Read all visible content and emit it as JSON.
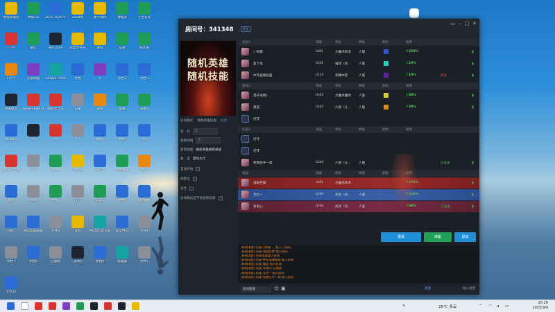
{
  "desktop": {
    "icons": [
      {
        "label": "地址和电话",
        "icon": "folder-icon",
        "color": "#e6b800"
      },
      {
        "label": "中级Gis",
        "icon": "excel-icon",
        "color": "#1f9c55"
      },
      {
        "label": "2025-2026学年",
        "icon": "word-icon",
        "color": "#2b6bd6"
      },
      {
        "label": "2024年",
        "icon": "folder-icon",
        "color": "#e6b800"
      },
      {
        "label": "教学资料",
        "icon": "folder-icon",
        "color": "#e6b800"
      },
      {
        "label": "课程表",
        "icon": "excel-icon",
        "color": "#1f9c55"
      },
      {
        "label": "学生名单",
        "icon": "excel-icon",
        "color": "#1f9c55"
      },
      {
        "label": "TTYY",
        "icon": "app-icon",
        "color": "#d8342f"
      },
      {
        "label": "微信",
        "icon": "wechat-icon",
        "color": "#1f9c55"
      },
      {
        "label": "WeGame",
        "icon": "wegame-icon",
        "color": "#1e2530"
      },
      {
        "label": "新建文件夹",
        "icon": "folder-icon",
        "color": "#e6b800"
      },
      {
        "label": "资料",
        "icon": "folder-icon",
        "color": "#e6b800"
      },
      {
        "label": "成绩",
        "icon": "excel-icon",
        "color": "#1f9c55"
      },
      {
        "label": "统计表",
        "icon": "excel-icon",
        "color": "#1f9c55"
      },
      {
        "label": "TTYYY",
        "icon": "app-icon",
        "color": "#e8870e"
      },
      {
        "label": "百度网盘",
        "icon": "app-icon",
        "color": "#7c3fc1"
      },
      {
        "label": "Google Chrome",
        "icon": "chrome-icon",
        "color": "#14a3a0"
      },
      {
        "label": "文档",
        "icon": "word-icon",
        "color": "#2b6bd6"
      },
      {
        "label": "AI",
        "icon": "ai-icon",
        "color": "#7c3fc1"
      },
      {
        "label": "文档2",
        "icon": "word-icon",
        "color": "#2b6bd6"
      },
      {
        "label": "文档3",
        "icon": "word-icon",
        "color": "#2b6bd6"
      },
      {
        "label": "英雄联盟",
        "icon": "game-icon",
        "color": "#1e2530"
      },
      {
        "label": "Apex Legends",
        "icon": "game-icon",
        "color": "#d8342f"
      },
      {
        "label": "网易云音乐",
        "icon": "music-icon",
        "color": "#d8342f"
      },
      {
        "label": "记录",
        "icon": "doc-icon",
        "color": "#8b8f99"
      },
      {
        "label": "游戏",
        "icon": "game-icon",
        "color": "#e8870e"
      },
      {
        "label": "表格",
        "icon": "excel-icon",
        "color": "#1f9c55"
      },
      {
        "label": "表格2",
        "icon": "excel-icon",
        "color": "#1f9c55"
      },
      {
        "label": "bilibili",
        "icon": "app-icon",
        "color": "#2b6bd6"
      },
      {
        "label": "PS",
        "icon": "ps-icon",
        "color": "#1e2530"
      },
      {
        "label": "XX",
        "icon": "app-icon",
        "color": "#d8342f"
      },
      {
        "label": "人人",
        "icon": "doc-icon",
        "color": "#8b8f99"
      },
      {
        "label": "文档4",
        "icon": "word-icon",
        "color": "#2b6bd6"
      },
      {
        "label": "文档5",
        "icon": "word-icon",
        "color": "#2b6bd6"
      },
      {
        "label": "QQ",
        "icon": "qq-icon",
        "color": "#2b6bd6"
      },
      {
        "label": "WPS Office",
        "icon": "wps-icon",
        "color": "#d8342f"
      },
      {
        "label": "TTT",
        "icon": "doc-icon",
        "color": "#8b8f99"
      },
      {
        "label": "文件",
        "icon": "doc-icon",
        "color": "#1f9c55"
      },
      {
        "label": "资料夹",
        "icon": "folder-icon",
        "color": "#e6b800"
      },
      {
        "label": "2025",
        "icon": "word-icon",
        "color": "#2b6bd6"
      },
      {
        "label": "文件管理",
        "icon": "app-icon",
        "color": "#1f9c55"
      },
      {
        "label": "用户",
        "icon": "user-icon",
        "color": "#e8870e"
      },
      {
        "label": "图片",
        "icon": "image-icon",
        "color": "#2b6bd6"
      },
      {
        "label": "MMM",
        "icon": "doc-icon",
        "color": "#8b8f99"
      },
      {
        "label": "文件2",
        "icon": "doc-icon",
        "color": "#1f9c55"
      },
      {
        "label": "TTT2",
        "icon": "doc-icon",
        "color": "#8b8f99"
      },
      {
        "label": "记录2",
        "icon": "excel-icon",
        "color": "#1f9c55"
      },
      {
        "label": "文档6",
        "icon": "word-icon",
        "color": "#2b6bd6"
      },
      {
        "label": "控制面板",
        "icon": "app-icon",
        "color": "#2b6bd6"
      },
      {
        "label": "KK",
        "icon": "app-icon",
        "color": "#2b6bd6"
      },
      {
        "label": "腾讯电脑管家",
        "icon": "app-icon",
        "color": "#2b6bd6"
      },
      {
        "label": "文件3",
        "icon": "doc-icon",
        "color": "#8b8f99"
      },
      {
        "label": "Bin",
        "icon": "app-icon",
        "color": "#e6b800"
      },
      {
        "label": "Microsoft Edge",
        "icon": "edge-icon",
        "color": "#14a3a0"
      },
      {
        "label": "安全中心",
        "icon": "app-icon",
        "color": "#2b6bd6"
      },
      {
        "label": "文件4",
        "icon": "doc-icon",
        "color": "#8b8f99"
      },
      {
        "label": "文档7",
        "icon": "doc-icon",
        "color": "#8b8f99"
      },
      {
        "label": "文档8",
        "icon": "word-icon",
        "color": "#2b6bd6"
      },
      {
        "label": "回收站",
        "icon": "recycle-icon",
        "color": "#8b8f99"
      },
      {
        "label": "游戏2",
        "icon": "game-icon",
        "color": "#1e2530"
      },
      {
        "label": "文档9",
        "icon": "word-icon",
        "color": "#2b6bd6"
      },
      {
        "label": "加速器",
        "icon": "app-icon",
        "color": "#14a3a0"
      },
      {
        "label": "文件5",
        "icon": "doc-icon",
        "color": "#8b8f99"
      },
      {
        "label": "文档10",
        "icon": "word-icon",
        "color": "#2b6bd6"
      }
    ]
  },
  "app": {
    "room_title": "房间号：341348",
    "room_tag": "房主",
    "banner": {
      "line1": "随机英雄",
      "line2": "随机技能"
    },
    "left_tabs": [
      "房间模式",
      "随机英雄技能",
      "分享"
    ],
    "left_fields": [
      {
        "label": "密　码",
        "value": "无"
      },
      {
        "label": "观看限制",
        "value": "无"
      },
      {
        "label": "游戏地图",
        "value": "随机英雄随机技能"
      },
      {
        "label": "类　型",
        "value": "游戏大厅"
      }
    ],
    "left_checks": [
      "自动开始",
      "观看位",
      "语音",
      "房间满员后不接受新玩家"
    ],
    "columns": {
      "level": "等级",
      "rank": "称号",
      "race": "种族",
      "color": "颜色",
      "win": "胜率"
    },
    "sections": [
      {
        "title": "主队1",
        "players": [
          {
            "name": "♪ 秋霜",
            "level": "LV61",
            "rank": "大魔术师术",
            "race": "人族",
            "color": "#2f52e0",
            "win": "↑250%",
            "tag": ""
          },
          {
            "name": "复下等",
            "level": "LV21",
            "rank": "强韧（初...",
            "race": "人族",
            "color": "#1fd1b5",
            "win": "↑10%",
            "tag": ""
          },
          {
            "name": "中年盖球屁股",
            "level": "LV13",
            "rank": "荣耀中忠",
            "race": "人族",
            "color": "#6a1fb0",
            "win": "↑10%",
            "tag": "房主"
          }
        ]
      },
      {
        "title": "组队2",
        "players": [
          {
            "name": "濡子很用）",
            "level": "LV63",
            "rank": "大魔术魔术",
            "race": "人族",
            "color": "#d6d21c",
            "win": "↑30%",
            "tag": ""
          },
          {
            "name": "墨莲",
            "level": "LV42",
            "rank": "六道（斗...",
            "race": "人族",
            "color": "#e8870e",
            "win": "↑20%",
            "tag": ""
          },
          {
            "name": "打开",
            "level": "",
            "rank": "",
            "race": "",
            "color": "",
            "win": "",
            "tag": ""
          }
        ]
      },
      {
        "title": "队伍3",
        "players": [
          {
            "name": "打开",
            "level": "",
            "rank": "",
            "race": "",
            "color": "",
            "win": "",
            "tag": ""
          },
          {
            "name": "打开",
            "level": "",
            "rank": "",
            "race": "",
            "color": "",
            "win": "",
            "tag": ""
          },
          {
            "name": "和我先手一样",
            "level": "LV44",
            "rank": "六道（斗...",
            "race": "人族",
            "color": "",
            "win": "",
            "tag": "已准备"
          }
        ]
      },
      {
        "title": "观战",
        "players": [
          {
            "name": "战隐巨擘",
            "level": "LV61",
            "rank": "大魔术师术",
            "race": "",
            "color": "",
            "win": "↑270%",
            "tag": ""
          },
          {
            "name": "宝贝~",
            "level": "LV30",
            "rank": "风剑（初...",
            "race": "人族",
            "color": "",
            "win": "↑110%",
            "tag": ""
          },
          {
            "name": "有限心",
            "level": "LV30",
            "rank": "风剑（初...",
            "race": "人族",
            "color": "",
            "win": "↑30%",
            "tag": "已准备"
          }
        ]
      }
    ],
    "buttons": {
      "invite": "邀请",
      "ready": "准备",
      "exit": "退出"
    },
    "chat": [
      "[系统消息] 玩家 ♪秋霜 ... 加入了房间。",
      "[系统消息] 玩家 战隐巨擘 加入房间",
      "[系统消息] 有新玩家加入房间",
      "[系统消息] 玩家 中年盖球屁股 加入房间",
      "[系统消息] 玩家 墨莲 加入房间",
      "[系统消息] 玩家 有限心 已准备",
      "[系统消息] 玩家 宝贝~ 加入房间",
      "[系统消息] 玩家 和我先手一样 加入房间"
    ],
    "chat_channel": "房间频道",
    "send_label": "发送",
    "add_friend_label": "加入语音"
  },
  "taskbar": {
    "weather": "25°C 多云",
    "time": "20:29",
    "date": "2025/9/9",
    "apps": [
      "start-icon",
      "search-icon",
      "qq-icon",
      "wps-icon",
      "ai-icon",
      "wechat-icon",
      "game-icon",
      "music-icon",
      "app-icon",
      "folder-icon"
    ]
  }
}
